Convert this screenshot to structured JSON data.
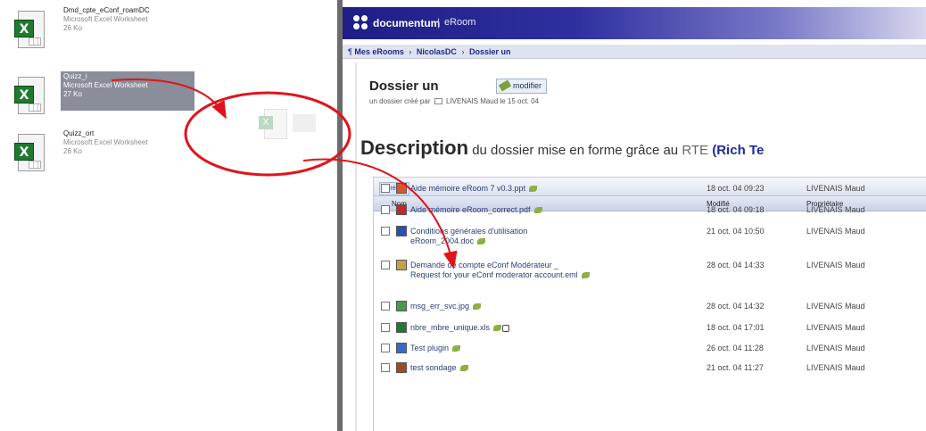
{
  "desktop": {
    "files": [
      {
        "name": "Dmd_cpte_eConf_roamDC",
        "type": "Microsoft Excel Worksheet",
        "size": "26 Ko"
      },
      {
        "name": "Quizz_i",
        "type": "Microsoft Excel Worksheet",
        "size": "27 Ko"
      },
      {
        "name": "Quizz_ort",
        "type": "Microsoft Excel Worksheet",
        "size": "26 Ko"
      }
    ]
  },
  "app": {
    "brand": "documentum",
    "separator": "|",
    "product": "eRoom"
  },
  "breadcrumb": {
    "items": [
      "Mes eRooms",
      "NicolasDC",
      "Dossier un"
    ],
    "divider": "›"
  },
  "folder": {
    "title": "Dossier un",
    "edit_label": "modifier",
    "created_prefix": "un dossier créé par",
    "created_user": "LIVENAIS Maud",
    "created_date": "le 15 oct. 04"
  },
  "description": {
    "bold": "Description",
    "rest": "du dossier mise en forme grâce au",
    "rte": "RTE",
    "rich": "(Rich Te"
  },
  "table": {
    "create_tab": "créer",
    "columns": {
      "name": "Nom",
      "modified": "Modifié",
      "owner": "Propriétaire"
    },
    "rows": [
      {
        "lines": [
          "Aide mémoire eRoom 7 v0.3.ppt"
        ],
        "date": "18 oct. 04  09:23",
        "owner": "LIVENAIS Maud",
        "icon_color": "#d8562a"
      },
      {
        "lines": [
          "Aide mémoire eRoom_correct.pdf"
        ],
        "date": "18 oct. 04  09:18",
        "owner": "LIVENAIS Maud",
        "icon_color": "#c0282a"
      },
      {
        "lines": [
          "Conditions générales d'utilisation",
          "eRoom_2004.doc"
        ],
        "date": "21 oct. 04  10:50",
        "owner": "LIVENAIS Maud",
        "icon_color": "#2a50b0"
      },
      {
        "lines": [
          "Demande de compte eConf Modérateur _",
          "Request for your eConf moderator account.eml"
        ],
        "date": "28 oct. 04  14:33",
        "owner": "LIVENAIS Maud",
        "icon_color": "#c2a24a"
      },
      {
        "lines": [
          "msg_err_svc.jpg"
        ],
        "date": "28 oct. 04  14:32",
        "owner": "LIVENAIS Maud",
        "icon_color": "#4a9a4a"
      },
      {
        "lines": [
          "nbre_mbre_unique.xls"
        ],
        "date": "18 oct. 04  17:01",
        "owner": "LIVENAIS Maud",
        "icon_color": "#1f7a30"
      },
      {
        "lines": [
          "Test plugin"
        ],
        "date": "26 oct. 04  11:28",
        "owner": "LIVENAIS Maud",
        "icon_color": "#3a6ac8"
      },
      {
        "lines": [
          "test sondage"
        ],
        "date": "21 oct. 04  11:27",
        "owner": "LIVENAIS Maud",
        "icon_color": "#a04a20"
      }
    ]
  },
  "colors": {
    "annotation": "#e0141a",
    "topbar": "#1e1e86",
    "link": "#1b2a8a"
  }
}
